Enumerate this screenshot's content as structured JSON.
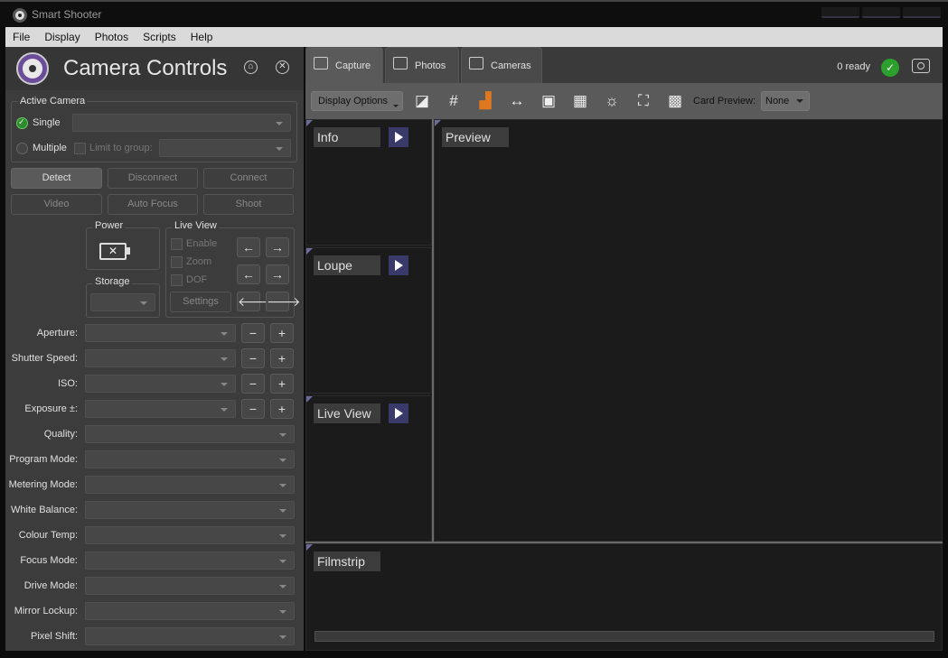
{
  "window": {
    "title": "Smart Shooter"
  },
  "menubar": {
    "items": [
      "File",
      "Display",
      "Photos",
      "Scripts",
      "Help"
    ]
  },
  "camera_controls": {
    "title": "Camera Controls",
    "active_camera": {
      "label": "Active Camera",
      "single_label": "Single",
      "multiple_label": "Multiple",
      "limit_label": "Limit to group:"
    },
    "buttons": {
      "detect": "Detect",
      "disconnect": "Disconnect",
      "connect": "Connect",
      "video": "Video",
      "auto_focus": "Auto Focus",
      "shoot": "Shoot"
    },
    "power_label": "Power",
    "storage_label": "Storage",
    "live_view": {
      "label": "Live View",
      "enable": "Enable",
      "zoom": "Zoom",
      "dof": "DOF",
      "settings": "Settings"
    },
    "arrows": [
      "←",
      "→",
      "←",
      "→",
      "🡐",
      "🡒"
    ],
    "step_buttons": {
      "minus": "−",
      "plus": "+"
    },
    "settings": [
      {
        "label": "Aperture:"
      },
      {
        "label": "Shutter Speed:"
      },
      {
        "label": "ISO:"
      },
      {
        "label": "Exposure ±:"
      },
      {
        "label": "Quality:"
      },
      {
        "label": "Program Mode:"
      },
      {
        "label": "Metering Mode:"
      },
      {
        "label": "White Balance:"
      },
      {
        "label": "Colour Temp:"
      },
      {
        "label": "Focus Mode:"
      },
      {
        "label": "Drive Mode:"
      },
      {
        "label": "Mirror Lockup:"
      },
      {
        "label": "Pixel Shift:"
      }
    ]
  },
  "tabs": [
    "Capture",
    "Photos",
    "Cameras"
  ],
  "status": {
    "ready_text": "0 ready"
  },
  "toolbar": {
    "display_options": "Display Options",
    "card_preview_label": "Card Preview:",
    "card_preview_value": "None",
    "accent_color": "#e07820"
  },
  "panes": {
    "info": "Info",
    "loupe": "Loupe",
    "live_view": "Live View",
    "preview": "Preview",
    "filmstrip": "Filmstrip"
  }
}
